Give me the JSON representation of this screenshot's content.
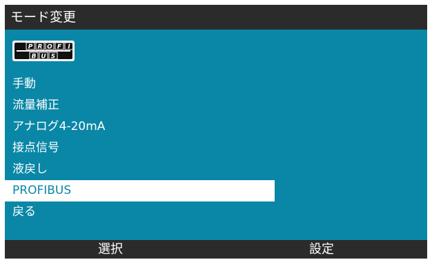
{
  "colors": {
    "background": "#0a87a6",
    "bar": "#2b2b2b",
    "text": "#ffffff",
    "selected_background": "#ffffff",
    "selected_text": "#0a87a6"
  },
  "header": {
    "title": "モード変更"
  },
  "logo": {
    "top_text": "PROFI",
    "bottom_text": "BUS"
  },
  "menu": {
    "items": [
      {
        "label": "手動",
        "selected": false
      },
      {
        "label": "流量補正",
        "selected": false
      },
      {
        "label": "アナログ4-20mA",
        "selected": false
      },
      {
        "label": "接点信号",
        "selected": false
      },
      {
        "label": "液戻し",
        "selected": false
      },
      {
        "label": "PROFIBUS",
        "selected": true
      },
      {
        "label": "戻る",
        "selected": false
      }
    ]
  },
  "softkeys": {
    "left_label": "選択",
    "right_label": "設定"
  }
}
